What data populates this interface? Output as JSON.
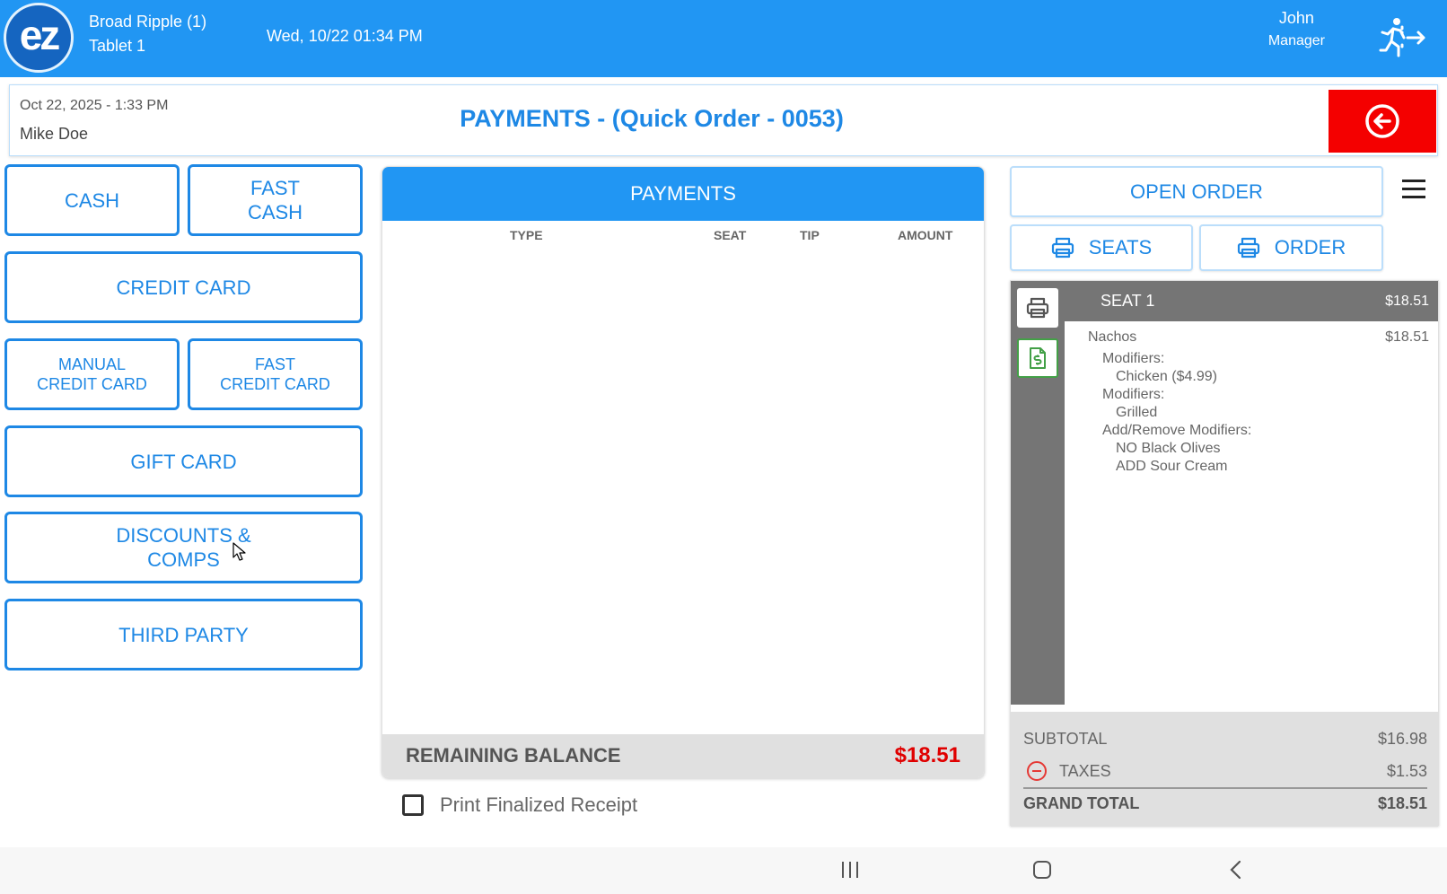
{
  "topbar": {
    "logo_text": "ez",
    "location": "Broad Ripple (1)",
    "device": "Tablet 1",
    "datetime": "Wed, 10/22 01:34 PM",
    "user_name": "John",
    "user_role": "Manager",
    "bg_color": "#2196f3",
    "logout_icon": "running-exit-icon"
  },
  "header": {
    "order_datetime": "Oct 22, 2025  - 1:33 PM",
    "customer": "Mike Doe",
    "title": "PAYMENTS - (Quick Order - 0053)",
    "back_icon": "back-arrow-icon",
    "back_color": "#f40000"
  },
  "payment_buttons": {
    "cash": "CASH",
    "fast_cash": "FAST\nCASH",
    "credit_card": "CREDIT CARD",
    "manual_credit_card": "MANUAL\nCREDIT CARD",
    "fast_credit_card": "FAST\nCREDIT CARD",
    "gift_card": "GIFT CARD",
    "discounts": "DISCOUNTS &\nCOMPS",
    "third_party": "THIRD PARTY"
  },
  "payments_panel": {
    "title": "PAYMENTS",
    "columns": [
      "TYPE",
      "SEAT",
      "TIP",
      "AMOUNT"
    ],
    "rows": [],
    "remaining_label": "REMAINING BALANCE",
    "remaining_value": "$18.51"
  },
  "print_receipt": {
    "label": "Print Finalized Receipt",
    "checked": false
  },
  "order_actions": {
    "open_order": "OPEN ORDER",
    "print_seats": "SEATS",
    "print_order": "ORDER",
    "menu_icon": "hamburger-menu-icon"
  },
  "seat": {
    "name": "SEAT 1",
    "amount": "$18.51",
    "items": [
      {
        "name": "Nachos",
        "price": "$18.51",
        "lines": [
          {
            "level": 1,
            "text": "Modifiers:"
          },
          {
            "level": 2,
            "text": "Chicken ($4.99)"
          },
          {
            "level": 1,
            "text": "Modifiers:"
          },
          {
            "level": 2,
            "text": "Grilled"
          },
          {
            "level": 1,
            "text": "Add/Remove Modifiers:"
          },
          {
            "level": 2,
            "text": "NO Black Olives"
          },
          {
            "level": 2,
            "text": "ADD Sour Cream"
          }
        ]
      }
    ]
  },
  "totals": {
    "subtotal_label": "SUBTOTAL",
    "subtotal": "$16.98",
    "taxes_label": "TAXES",
    "taxes": "$1.53",
    "grand_label": "GRAND TOTAL",
    "grand": "$18.51"
  }
}
